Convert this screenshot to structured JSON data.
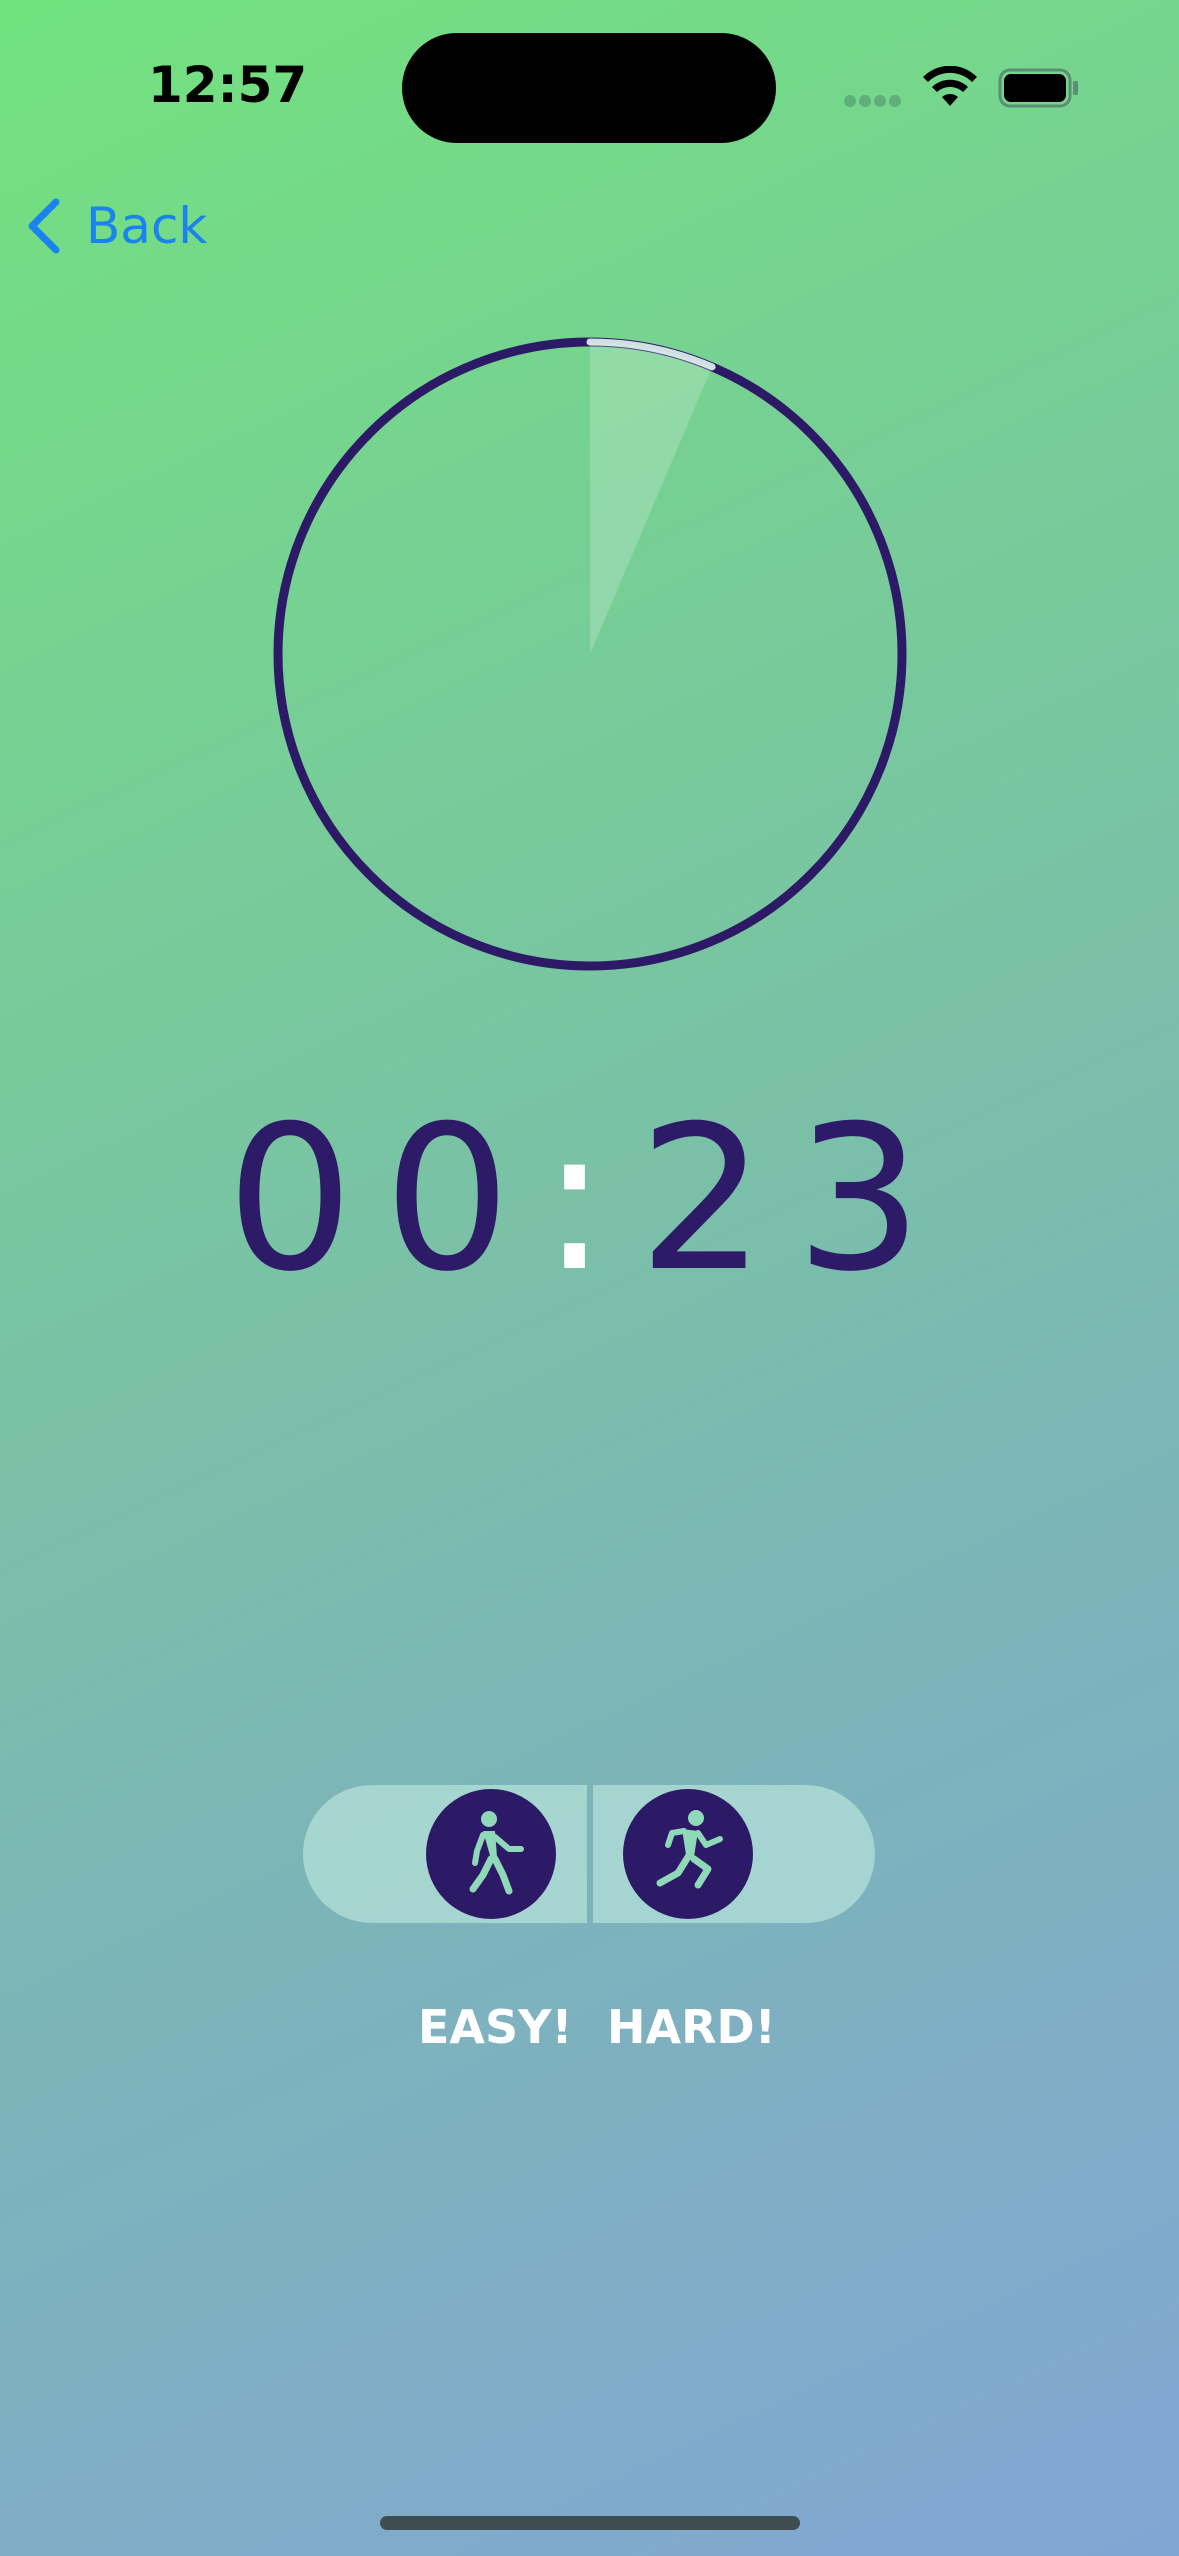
{
  "status_bar": {
    "time": "12:57",
    "icons": [
      "cellular-signal-icon",
      "wifi-icon",
      "battery-icon"
    ]
  },
  "nav": {
    "back_label": "Back",
    "back_icon": "chevron-left-icon"
  },
  "progress": {
    "fraction": 0.064
  },
  "timer": {
    "minutes_tens": "0",
    "minutes_ones": "0",
    "separator": ":",
    "seconds_tens": "2",
    "seconds_ones": "3"
  },
  "modes": [
    {
      "icon": "walking-figure-icon",
      "label": "EASY!"
    },
    {
      "icon": "running-figure-icon",
      "label": "HARD!"
    }
  ],
  "colors": {
    "accent": "#2d1a66",
    "link": "#1a83ee",
    "gradient_start": "#72e27e",
    "gradient_end": "#82a6d4"
  }
}
